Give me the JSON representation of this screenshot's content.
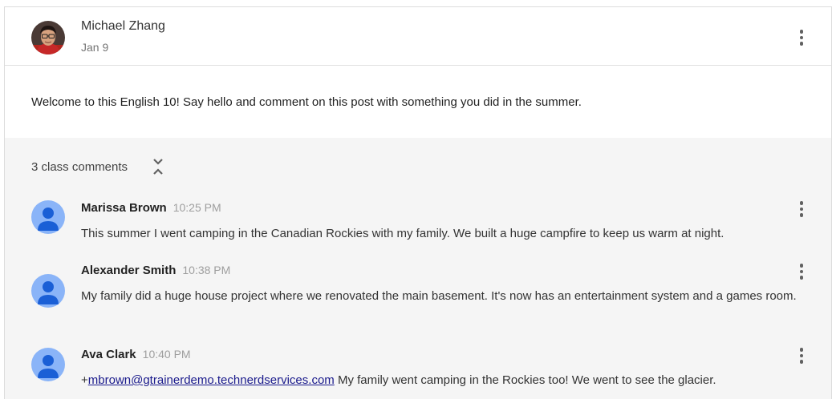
{
  "post": {
    "author": "Michael Zhang",
    "date": "Jan 9",
    "body": "Welcome to this English 10! Say hello and comment on this post with something you did in the summer."
  },
  "comments_section": {
    "count_label": "3 class comments",
    "comments": [
      {
        "author": "Marissa Brown",
        "time": "10:25 PM",
        "text": "This summer I went camping in the Canadian Rockies with my family. We built a huge campfire to keep us warm at night."
      },
      {
        "author": "Alexander Smith",
        "time": "10:38 PM",
        "text": "My family did a huge house project where we renovated the main basement. It's now has an entertainment system and a games room."
      },
      {
        "author": "Ava Clark",
        "time": "10:40 PM",
        "mention_prefix": "+",
        "mention": "mbrown@gtrainerdemo.technerdservices.com",
        "text": " My family went camping in the Rockies too! We went to see the glacier."
      }
    ]
  },
  "icons": {
    "author_avatar": "profile-photo",
    "comment_avatar": "default-person-avatar",
    "more": "more-vert-icon",
    "collapse": "unfold-less-icon"
  },
  "colors": {
    "avatar_blue": "#8ab4f8",
    "avatar_figure": "#1a5fd6",
    "comments_bg": "#f5f5f5",
    "mention": "#1a1a8c"
  }
}
